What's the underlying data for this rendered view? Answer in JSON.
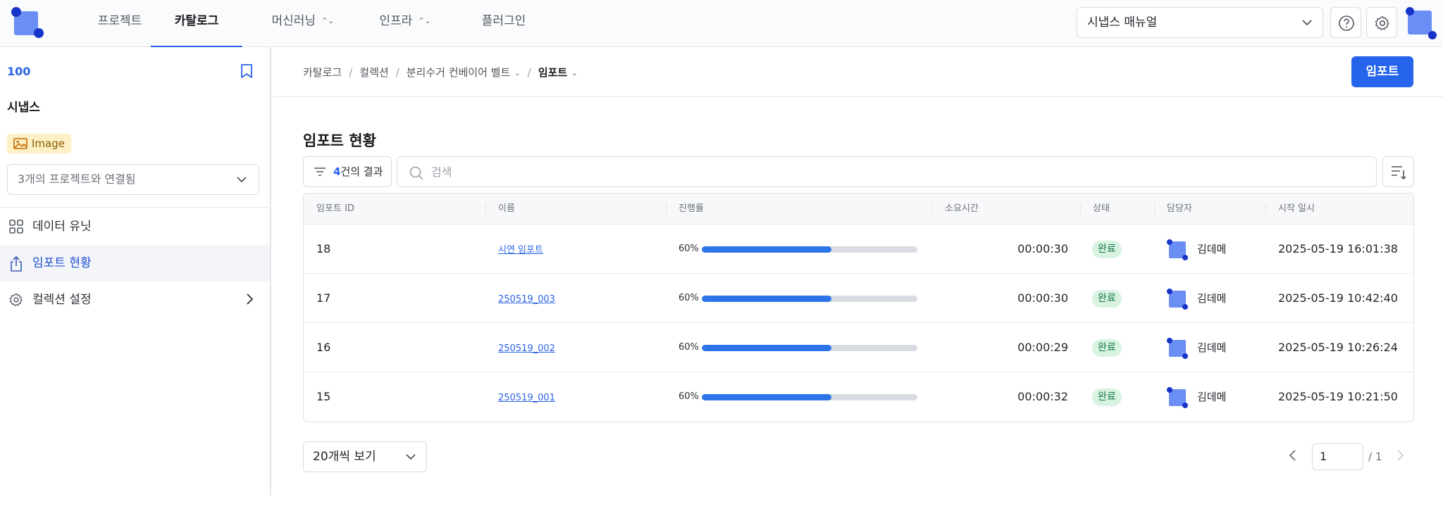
{
  "nav": {
    "tabs": [
      {
        "label": "프로젝트"
      },
      {
        "label": "카탈로그"
      },
      {
        "label": "머신러닝"
      },
      {
        "label": "인프라"
      },
      {
        "label": "플러그인"
      }
    ],
    "manual_select": "시냅스 매뉴얼"
  },
  "sidebar": {
    "id": "100",
    "name": "시냅스",
    "badge": "Image",
    "project_select": "3개의 프로젝트와 연결됨",
    "items": [
      {
        "label": "데이터 유닛",
        "icon": "grid-icon"
      },
      {
        "label": "임포트 현황",
        "icon": "upload-icon"
      },
      {
        "label": "컬렉션 설정",
        "icon": "gear-icon"
      }
    ]
  },
  "breadcrumb": {
    "items": [
      "카탈로그",
      "컬렉션",
      "분리수거 컨베이어 벨트",
      "임포트"
    ]
  },
  "header": {
    "import_button": "임포트"
  },
  "section": {
    "title": "임포트 현황",
    "result_count": "4",
    "result_suffix": "건의 결과",
    "search_placeholder": "검색"
  },
  "table": {
    "columns": [
      "임포트 ID",
      "이름",
      "진행률",
      "소요시간",
      "상태",
      "담당자",
      "시작 일시"
    ],
    "rows": [
      {
        "id": "18",
        "name": "시연 임포트",
        "progress": 60,
        "progress_label": "60%",
        "duration": "00:00:30",
        "status": "완료",
        "owner": "김데메",
        "started": "2025-05-19 16:01:38"
      },
      {
        "id": "17",
        "name": "250519_003",
        "progress": 60,
        "progress_label": "60%",
        "duration": "00:00:30",
        "status": "완료",
        "owner": "김데메",
        "started": "2025-05-19 10:42:40"
      },
      {
        "id": "16",
        "name": "250519_002",
        "progress": 60,
        "progress_label": "60%",
        "duration": "00:00:29",
        "status": "완료",
        "owner": "김데메",
        "started": "2025-05-19 10:26:24"
      },
      {
        "id": "15",
        "name": "250519_001",
        "progress": 60,
        "progress_label": "60%",
        "duration": "00:00:32",
        "status": "완료",
        "owner": "김데메",
        "started": "2025-05-19 10:21:50"
      }
    ]
  },
  "pagination": {
    "page_size": "20개씩 보기",
    "current_page": "1",
    "total": "/ 1"
  },
  "colors": {
    "accent": "#2564eb",
    "status_bg": "#d8f3e2",
    "status_text": "#18794a",
    "progress_fill": "#2d74e8"
  }
}
